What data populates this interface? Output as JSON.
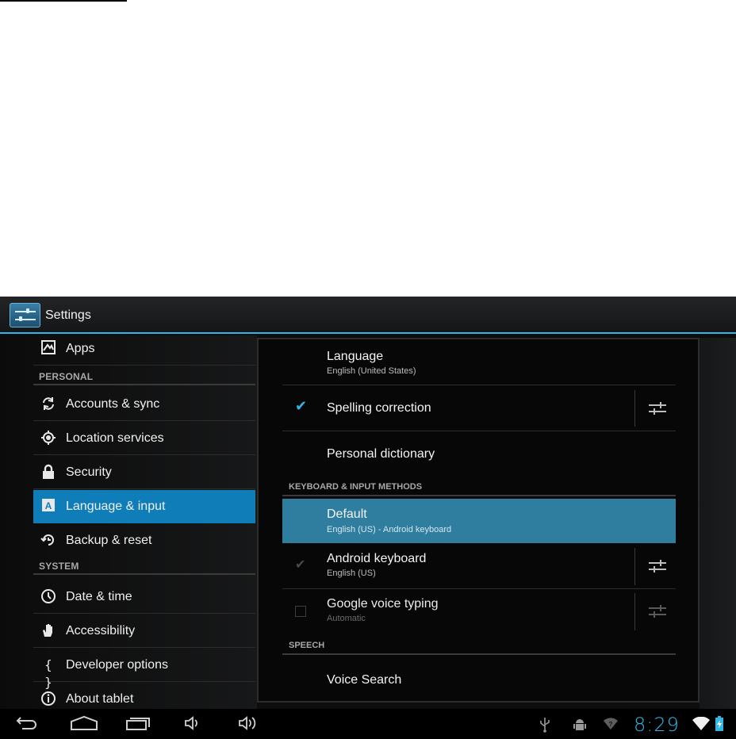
{
  "app": {
    "title": "Settings",
    "icon": "settings-sliders-icon"
  },
  "nav": {
    "items": [
      {
        "label": "Apps",
        "icon": "apps-icon"
      },
      {
        "header": "PERSONAL"
      },
      {
        "label": "Accounts & sync",
        "icon": "sync-icon"
      },
      {
        "label": "Location services",
        "icon": "location-icon"
      },
      {
        "label": "Security",
        "icon": "lock-icon"
      },
      {
        "label": "Language & input",
        "icon": "language-icon",
        "selected": true
      },
      {
        "label": "Backup & reset",
        "icon": "backup-icon"
      },
      {
        "header": "SYSTEM"
      },
      {
        "label": "Date & time",
        "icon": "clock-icon"
      },
      {
        "label": "Accessibility",
        "icon": "hand-icon"
      },
      {
        "label": "Developer options",
        "icon": "braces-icon"
      },
      {
        "label": "About tablet",
        "icon": "info-icon"
      }
    ]
  },
  "detail": {
    "language": {
      "title": "Language",
      "summary": "English (United States)"
    },
    "spelling": {
      "title": "Spelling correction",
      "checked": true
    },
    "dictionary": {
      "title": "Personal dictionary"
    },
    "keyboard_header": "KEYBOARD & INPUT METHODS",
    "default": {
      "title": "Default",
      "summary": "English (US) - Android keyboard"
    },
    "android_keyboard": {
      "title": "Android keyboard",
      "summary": "English (US)",
      "checked": true,
      "enabled": false
    },
    "voice_typing": {
      "title": "Google voice typing",
      "summary": "Automatic",
      "checked": false
    },
    "speech_header": "SPEECH",
    "voice_search": {
      "title": "Voice Search"
    }
  },
  "sysbar": {
    "time": "8:29",
    "accent": "#33b5e5",
    "nav_icons": [
      "back-icon",
      "home-icon",
      "recent-apps-icon",
      "volume-down-icon",
      "volume-up-icon"
    ],
    "status_icons": [
      "usb-icon",
      "android-debug-icon",
      "wifi-notification-icon",
      "wifi-signal-icon",
      "battery-icon"
    ]
  }
}
